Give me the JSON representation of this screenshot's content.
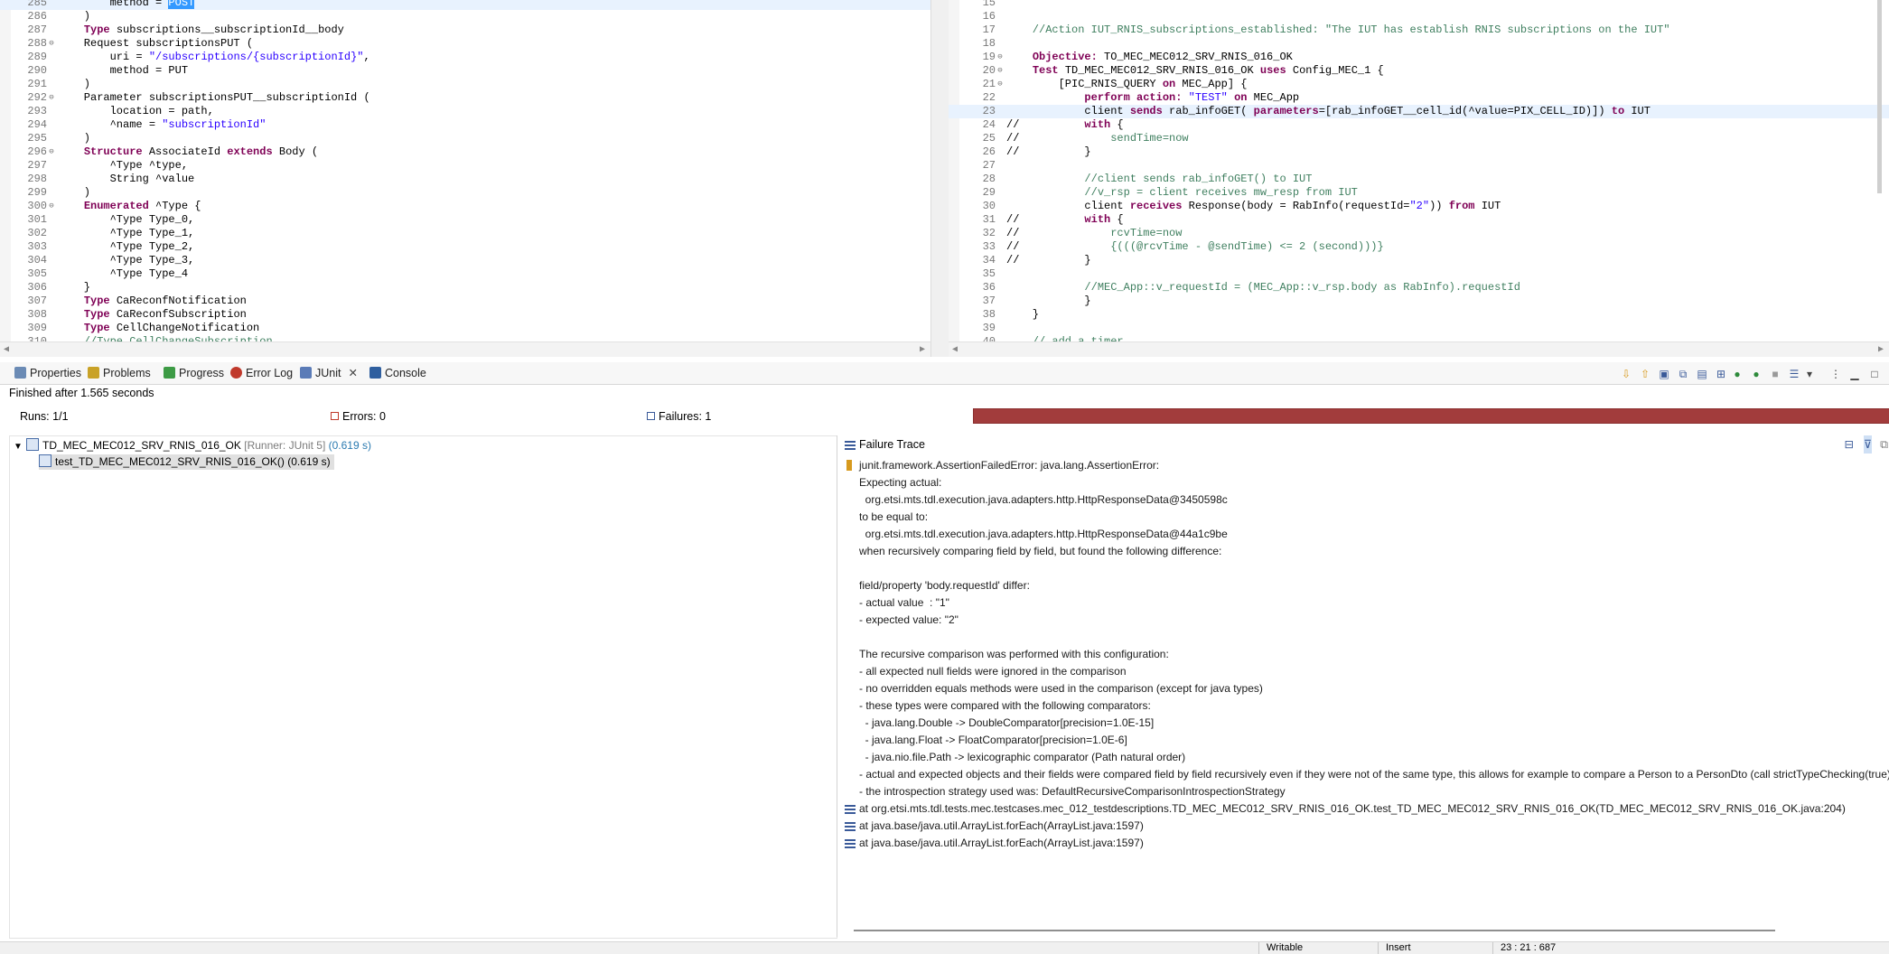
{
  "editor_left": {
    "lines": [
      {
        "n": "285",
        "fold": "",
        "tokens": [
          [
            "",
            "        method = "
          ],
          [
            "sel",
            "POST"
          ]
        ],
        "hl": true
      },
      {
        "n": "286",
        "fold": "",
        "tokens": [
          [
            "",
            "    )"
          ]
        ]
      },
      {
        "n": "287",
        "fold": "",
        "tokens": [
          [
            "",
            "    "
          ],
          [
            "kw",
            "Type"
          ],
          [
            "",
            " subscriptions__subscriptionId__body"
          ]
        ]
      },
      {
        "n": "288",
        "fold": "-",
        "tokens": [
          [
            "",
            "    Request subscriptionsPUT ("
          ]
        ]
      },
      {
        "n": "289",
        "fold": "",
        "tokens": [
          [
            "",
            "        uri = "
          ],
          [
            "str",
            "\"/subscriptions/{subscriptionId}\""
          ],
          [
            "",
            ","
          ]
        ]
      },
      {
        "n": "290",
        "fold": "",
        "tokens": [
          [
            "",
            "        method = PUT"
          ]
        ]
      },
      {
        "n": "291",
        "fold": "",
        "tokens": [
          [
            "",
            "    )"
          ]
        ]
      },
      {
        "n": "292",
        "fold": "-",
        "tokens": [
          [
            "",
            "    Parameter subscriptionsPUT__subscriptionId ("
          ]
        ]
      },
      {
        "n": "293",
        "fold": "",
        "tokens": [
          [
            "",
            "        location = path,"
          ]
        ]
      },
      {
        "n": "294",
        "fold": "",
        "tokens": [
          [
            "",
            "        ^name = "
          ],
          [
            "str",
            "\"subscriptionId\""
          ]
        ]
      },
      {
        "n": "295",
        "fold": "",
        "tokens": [
          [
            "",
            "    )"
          ]
        ]
      },
      {
        "n": "296",
        "fold": "-",
        "tokens": [
          [
            "",
            "    "
          ],
          [
            "kw",
            "Structure"
          ],
          [
            "",
            " AssociateId "
          ],
          [
            "kw",
            "extends"
          ],
          [
            "",
            " Body ("
          ]
        ]
      },
      {
        "n": "297",
        "fold": "",
        "tokens": [
          [
            "",
            "        ^Type ^type,"
          ]
        ]
      },
      {
        "n": "298",
        "fold": "",
        "tokens": [
          [
            "",
            "        String ^value"
          ]
        ]
      },
      {
        "n": "299",
        "fold": "",
        "tokens": [
          [
            "",
            "    )"
          ]
        ]
      },
      {
        "n": "300",
        "fold": "-",
        "tokens": [
          [
            "",
            "    "
          ],
          [
            "kw",
            "Enumerated"
          ],
          [
            "",
            " ^Type {"
          ]
        ]
      },
      {
        "n": "301",
        "fold": "",
        "tokens": [
          [
            "",
            "        ^Type Type_0,"
          ]
        ]
      },
      {
        "n": "302",
        "fold": "",
        "tokens": [
          [
            "",
            "        ^Type Type_1,"
          ]
        ]
      },
      {
        "n": "303",
        "fold": "",
        "tokens": [
          [
            "",
            "        ^Type Type_2,"
          ]
        ]
      },
      {
        "n": "304",
        "fold": "",
        "tokens": [
          [
            "",
            "        ^Type Type_3,"
          ]
        ]
      },
      {
        "n": "305",
        "fold": "",
        "tokens": [
          [
            "",
            "        ^Type Type_4"
          ]
        ]
      },
      {
        "n": "306",
        "fold": "",
        "tokens": [
          [
            "",
            "    }"
          ]
        ]
      },
      {
        "n": "307",
        "fold": "",
        "tokens": [
          [
            "",
            "    "
          ],
          [
            "kw",
            "Type"
          ],
          [
            "",
            " CaReconfNotification"
          ]
        ]
      },
      {
        "n": "308",
        "fold": "",
        "tokens": [
          [
            "",
            "    "
          ],
          [
            "kw",
            "Type"
          ],
          [
            "",
            " CaReconfSubscription"
          ]
        ]
      },
      {
        "n": "309",
        "fold": "",
        "tokens": [
          [
            "",
            "    "
          ],
          [
            "kw",
            "Type"
          ],
          [
            "",
            " CellChangeNotification"
          ]
        ]
      },
      {
        "n": "310",
        "fold": "",
        "tokens": [
          [
            "cm",
            "    //Type CellChangeSubscription"
          ]
        ]
      }
    ]
  },
  "editor_right": {
    "lines": [
      {
        "n": "15",
        "fold": "",
        "tokens": []
      },
      {
        "n": "16",
        "fold": "",
        "tokens": []
      },
      {
        "n": "17",
        "fold": "",
        "tokens": [
          [
            "cm",
            "    //Action IUT_RNIS_subscriptions_established: \"The IUT has establish RNIS subscriptions on the IUT\""
          ]
        ]
      },
      {
        "n": "18",
        "fold": "",
        "tokens": []
      },
      {
        "n": "19",
        "fold": "-",
        "tokens": [
          [
            "",
            "    "
          ],
          [
            "kw",
            "Objective:"
          ],
          [
            "",
            " TO_MEC_MEC012_SRV_RNIS_016_OK"
          ]
        ]
      },
      {
        "n": "20",
        "fold": "-",
        "tokens": [
          [
            "",
            "    "
          ],
          [
            "kw",
            "Test"
          ],
          [
            "",
            " TD_MEC_MEC012_SRV_RNIS_016_OK "
          ],
          [
            "kw",
            "uses"
          ],
          [
            "",
            " Config_MEC_1 {"
          ]
        ]
      },
      {
        "n": "21",
        "fold": "-",
        "tokens": [
          [
            "",
            "        [PIC_RNIS_QUERY "
          ],
          [
            "kw",
            "on"
          ],
          [
            "",
            " MEC_App] {"
          ]
        ]
      },
      {
        "n": "22",
        "fold": "",
        "tokens": [
          [
            "",
            "            "
          ],
          [
            "kw",
            "perform action:"
          ],
          [
            "",
            " "
          ],
          [
            "str",
            "\"TEST\""
          ],
          [
            "",
            " "
          ],
          [
            "kw",
            "on"
          ],
          [
            "",
            " MEC_App"
          ]
        ]
      },
      {
        "n": "23",
        "fold": "",
        "tokens": [
          [
            "",
            "            client "
          ],
          [
            "kw",
            "sends"
          ],
          [
            "",
            " rab_infoGET( "
          ],
          [
            "kw",
            "parameters"
          ],
          [
            "",
            "=[rab_infoGET__cell_id(^value=PIX_CELL_ID)]) "
          ],
          [
            "kw",
            "to"
          ],
          [
            "",
            " IUT"
          ]
        ],
        "hl": true
      },
      {
        "n": "24",
        "fold": "",
        "tokens": [
          [
            "",
            "//          "
          ],
          [
            "kw",
            "with"
          ],
          [
            "",
            " {"
          ]
        ]
      },
      {
        "n": "25",
        "fold": "",
        "tokens": [
          [
            "",
            "//              "
          ],
          [
            "cm",
            "sendTime=now"
          ]
        ]
      },
      {
        "n": "26",
        "fold": "",
        "tokens": [
          [
            "",
            "//          }"
          ]
        ]
      },
      {
        "n": "27",
        "fold": "",
        "tokens": []
      },
      {
        "n": "28",
        "fold": "",
        "tokens": [
          [
            "cm",
            "            //client sends rab_infoGET() to IUT"
          ]
        ]
      },
      {
        "n": "29",
        "fold": "",
        "tokens": [
          [
            "cm",
            "            //v_rsp = client receives mw_resp from IUT"
          ]
        ]
      },
      {
        "n": "30",
        "fold": "",
        "tokens": [
          [
            "",
            "            client "
          ],
          [
            "kw",
            "receives"
          ],
          [
            "",
            " Response(body = RabInfo(requestId="
          ],
          [
            "str",
            "\"2\""
          ],
          [
            "",
            "))"
          ],
          [
            "",
            " "
          ],
          [
            "kw",
            "from"
          ],
          [
            "",
            " IUT"
          ]
        ]
      },
      {
        "n": "31",
        "fold": "",
        "tokens": [
          [
            "",
            "//          "
          ],
          [
            "kw",
            "with"
          ],
          [
            "",
            " {"
          ]
        ]
      },
      {
        "n": "32",
        "fold": "",
        "tokens": [
          [
            "",
            "//              "
          ],
          [
            "cm",
            "rcvTime=now"
          ]
        ]
      },
      {
        "n": "33",
        "fold": "",
        "tokens": [
          [
            "",
            "//              "
          ],
          [
            "cm",
            "{(((@rcvTime - @sendTime) <= 2 (second)))}"
          ]
        ]
      },
      {
        "n": "34",
        "fold": "",
        "tokens": [
          [
            "",
            "//          }"
          ]
        ]
      },
      {
        "n": "35",
        "fold": "",
        "tokens": []
      },
      {
        "n": "36",
        "fold": "",
        "tokens": [
          [
            "cm",
            "            //MEC_App::v_requestId = (MEC_App::v_rsp.body as RabInfo).requestId"
          ]
        ]
      },
      {
        "n": "37",
        "fold": "",
        "tokens": [
          [
            "",
            "            }"
          ]
        ]
      },
      {
        "n": "38",
        "fold": "",
        "tokens": [
          [
            "",
            "    }"
          ]
        ]
      },
      {
        "n": "39",
        "fold": "",
        "tokens": []
      },
      {
        "n": "40",
        "fold": "",
        "tokens": [
          [
            "cm",
            "    // add a timer"
          ]
        ]
      }
    ]
  },
  "tabs": [
    {
      "label": "Properties",
      "icon": "properties-icon",
      "color": "#6b8bb5"
    },
    {
      "label": "Problems",
      "icon": "problems-icon",
      "color": "#c9a227"
    },
    {
      "label": "Progress",
      "icon": "progress-icon",
      "color": "#3d9b45"
    },
    {
      "label": "Error Log",
      "icon": "error-log-icon",
      "color": "#c0392b"
    },
    {
      "label": "JUnit",
      "icon": "junit-icon",
      "color": "#5a7bb7"
    },
    {
      "label": "Console",
      "icon": "console-icon",
      "color": "#2f5f9f"
    }
  ],
  "junit": {
    "status": "Finished after 1.565 seconds",
    "runs_label": "Runs:",
    "runs_value": "1/1",
    "errors_label": "Errors:",
    "errors_value": "0",
    "failures_label": "Failures:",
    "failures_value": "1",
    "bar_color": "#a23c3c",
    "tree": {
      "suite_name": "TD_MEC_MEC012_SRV_RNIS_016_OK",
      "suite_runner": "[Runner: JUnit 5]",
      "suite_time": "(0.619 s)",
      "test_name": "test_TD_MEC_MEC012_SRV_RNIS_016_OK() (0.619 s)"
    },
    "trace_title": "Failure Trace",
    "trace_lines": [
      "junit.framework.AssertionFailedError: java.lang.AssertionError:",
      "Expecting actual:",
      "  org.etsi.mts.tdl.execution.java.adapters.http.HttpResponseData@3450598c",
      "to be equal to:",
      "  org.etsi.mts.tdl.execution.java.adapters.http.HttpResponseData@44a1c9be",
      "when recursively comparing field by field, but found the following difference:",
      "",
      "field/property 'body.requestId' differ:",
      "- actual value  : \"1\"",
      "- expected value: \"2\"",
      "",
      "The recursive comparison was performed with this configuration:",
      "- all expected null fields were ignored in the comparison",
      "- no overridden equals methods were used in the comparison (except for java types)",
      "- these types were compared with the following comparators:",
      "  - java.lang.Double -> DoubleComparator[precision=1.0E-15]",
      "  - java.lang.Float -> FloatComparator[precision=1.0E-6]",
      "  - java.nio.file.Path -> lexicographic comparator (Path natural order)",
      "- actual and expected objects and their fields were compared field by field recursively even if they were not of the same type, this allows for example to compare a Person to a PersonDto (call strictTypeChecking(true) to",
      "- the introspection strategy used was: DefaultRecursiveComparisonIntrospectionStrategy"
    ],
    "stack_lines": [
      "at org.etsi.mts.tdl.tests.mec.testcases.mec_012_testdescriptions.TD_MEC_MEC012_SRV_RNIS_016_OK.test_TD_MEC_MEC012_SRV_RNIS_016_OK(TD_MEC_MEC012_SRV_RNIS_016_OK.java:204)",
      "at java.base/java.util.ArrayList.forEach(ArrayList.java:1597)",
      "at java.base/java.util.ArrayList.forEach(ArrayList.java:1597)"
    ]
  },
  "statusbar": {
    "writable": "Writable",
    "insert": "Insert",
    "position": "23 : 21 : 687"
  }
}
